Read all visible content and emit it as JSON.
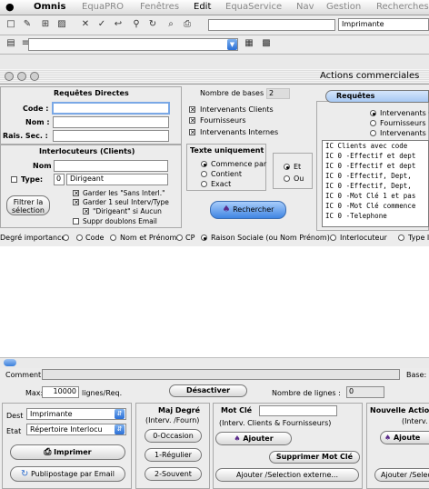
{
  "menubar": {
    "app": "Omnis",
    "items": [
      "EquaPRO",
      "Fenêtres",
      "Edit",
      "EquaService",
      "Nav",
      "Gestion",
      "Recherches"
    ]
  },
  "toolbar": {
    "printer_select": "Imprimante"
  },
  "window": {
    "title": "Actions commerciales"
  },
  "requetes_directes": {
    "title": "Requêtes Directes",
    "code_label": "Code :",
    "nom_label": "Nom :",
    "rais_label": "Rais. Sec. :",
    "nombre_label": "Nombre de bases :",
    "nombre_value": "2"
  },
  "intervenants": {
    "clients": "Intervenants Clients",
    "fournisseurs": "Fournisseurs",
    "internes": "Intervenants Internes"
  },
  "interlocuteurs": {
    "title": "Interlocuteurs (Clients)",
    "nom_label": "Nom :",
    "type_label": "Type:",
    "type_value": "0",
    "type_name": "Dirigeant",
    "filter_button": "Filtrer la\nsélection",
    "opt1": "Garder les \"Sans Interl.\"",
    "opt2": "Garder 1 seul Interv/Type",
    "opt3": "\"Dirigeant\" si Aucun",
    "opt4": "Suppr doublons Email"
  },
  "texte": {
    "title": "Texte uniquement",
    "commence": "Commence par",
    "contient": "Contient",
    "exact": "Exact",
    "et": "Et",
    "ou": "Ou"
  },
  "rechercher_button": "Rechercher",
  "requetes": {
    "tab": "Requêtes",
    "opt_clients": "Intervenants C",
    "opt_fourn": "Fournisseurs",
    "opt_internes": "Intervenants I",
    "list": [
      "IC  Clients avec code",
      "IC 0 -Effectif et dept",
      "IC 0 -Effectif et dept",
      "IC 0 -Effectif, Dept,",
      "IC 0 -Effectif, Dept,",
      "IC 0 -Mot Clé 1 et pas",
      "IC 0 -Mot Clé commence",
      "IC 0 -Telephone"
    ]
  },
  "sort_row": {
    "label": "Degré importance",
    "code": "Code",
    "nom_prenom": "Nom et Prénom",
    "cp": "CP",
    "raison": "Raison Sociale (ou Nom Prénom)",
    "interlocuteur": "Interlocuteur",
    "type": "Type I"
  },
  "bottom": {
    "comment_label": "Comment:",
    "base_label": "Base:",
    "max_label": "Max:",
    "max_value": "10000",
    "lignes_req": "lignes/Req.",
    "desactiver": "Désactiver",
    "nombre_lignes": "Nombre de lignes :",
    "nombre_lignes_value": "0",
    "dest_label": "Dest",
    "dest_value": "Imprimante",
    "etat_label": "Etat",
    "etat_value": "Répertoire Interlocu",
    "imprimer": "Imprimer",
    "publipostage": "Publipostage par Email",
    "maj_title": "Maj Degré",
    "maj_sub": "(Interv. /Fourn)",
    "occasion": "0-Occasion",
    "regulier": "1-Régulier",
    "souvent": "2-Souvent",
    "motcle_title": "Mot Clé",
    "motcle_sub": "(Interv. Clients & Fournisseurs)",
    "ajouter": "Ajouter",
    "supprimer": "Supprimer Mot Clé",
    "ajouter_sel": "Ajouter /Selection externe...",
    "nouvelle_title": "Nouvelle Actio",
    "nouvelle_sub": "(Interv.",
    "ajouter2": "Ajoute",
    "ajouter_sel2": "Ajouter /Selec"
  }
}
